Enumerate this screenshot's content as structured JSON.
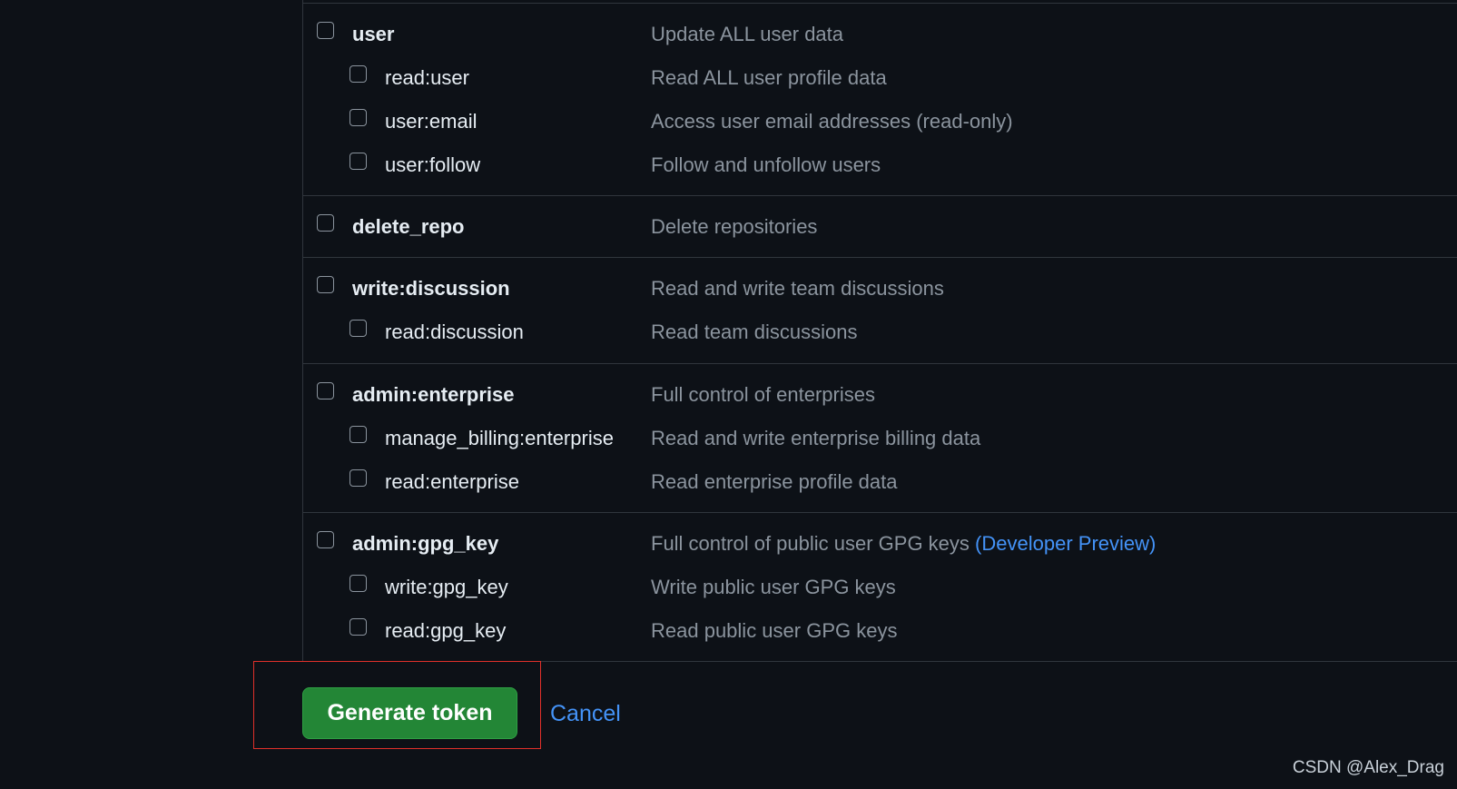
{
  "scopes": [
    {
      "name": "user",
      "description": "Update ALL user data",
      "children": [
        {
          "name": "read:user",
          "description": "Read ALL user profile data"
        },
        {
          "name": "user:email",
          "description": "Access user email addresses (read-only)"
        },
        {
          "name": "user:follow",
          "description": "Follow and unfollow users"
        }
      ]
    },
    {
      "name": "delete_repo",
      "description": "Delete repositories",
      "children": []
    },
    {
      "name": "write:discussion",
      "description": "Read and write team discussions",
      "children": [
        {
          "name": "read:discussion",
          "description": "Read team discussions"
        }
      ]
    },
    {
      "name": "admin:enterprise",
      "description": "Full control of enterprises",
      "children": [
        {
          "name": "manage_billing:enterprise",
          "description": "Read and write enterprise billing data"
        },
        {
          "name": "read:enterprise",
          "description": "Read enterprise profile data"
        }
      ]
    },
    {
      "name": "admin:gpg_key",
      "description": "Full control of public user GPG keys",
      "description_link": "(Developer Preview)",
      "children": [
        {
          "name": "write:gpg_key",
          "description": "Write public user GPG keys"
        },
        {
          "name": "read:gpg_key",
          "description": "Read public user GPG keys"
        }
      ]
    }
  ],
  "actions": {
    "generate_label": "Generate token",
    "cancel_label": "Cancel"
  },
  "watermark": "CSDN @Alex_Drag",
  "colors": {
    "background": "#0d1117",
    "border": "#30363d",
    "text": "#e6edf3",
    "muted": "#8b949e",
    "link": "#4493f8",
    "primary": "#238636",
    "highlight": "#e0302a"
  }
}
